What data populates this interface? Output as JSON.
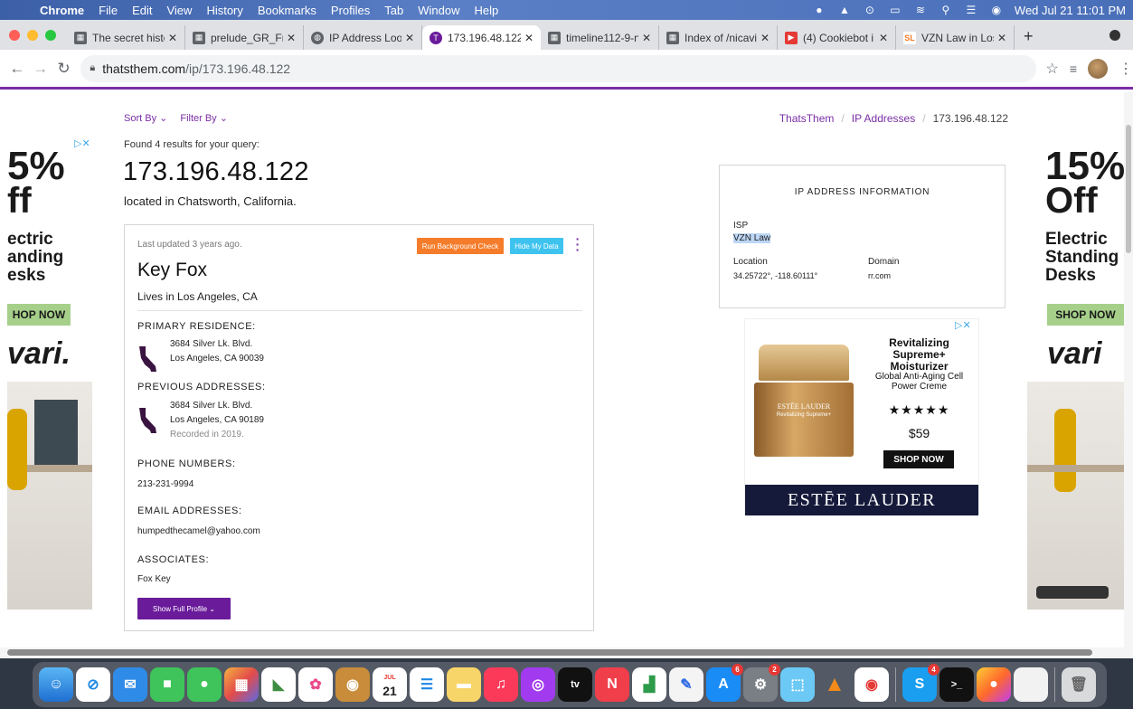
{
  "menubar": {
    "app": "Chrome",
    "items": [
      "File",
      "Edit",
      "View",
      "History",
      "Bookmarks",
      "Profiles",
      "Tab",
      "Window",
      "Help"
    ],
    "clock": "Wed Jul 21  11:01 PM"
  },
  "tabs": [
    {
      "title": "The secret histo",
      "color": "#5f6368",
      "icon": "doc-icon"
    },
    {
      "title": "prelude_GR_Fr",
      "color": "#5f6368",
      "icon": "doc-icon"
    },
    {
      "title": "IP Address Look",
      "color": "#5f6368",
      "icon": "globe-icon"
    },
    {
      "title": "173.196.48.122",
      "color": "#6a1b9a",
      "icon": "thatsthem-icon",
      "active": true
    },
    {
      "title": "timeline112-9-n",
      "color": "#5f6368",
      "icon": "doc-icon"
    },
    {
      "title": "Index of /nicavi",
      "color": "#5f6368",
      "icon": "doc-icon"
    },
    {
      "title": "(4) Cookiebot i",
      "color": "#e53935",
      "icon": "youtube-icon"
    },
    {
      "title": "VZN Law in Los",
      "color": "#f57c2a",
      "icon": "sl-icon"
    }
  ],
  "address": {
    "host": "thatsthem.com",
    "path": "/ip/173.196.48.122"
  },
  "controls": {
    "sort": "Sort By ⌄",
    "filter": "Filter By ⌄"
  },
  "breadcrumb": [
    "ThatsThem",
    "IP Addresses",
    "173.196.48.122"
  ],
  "results": {
    "found": "Found 4 results for your query:",
    "ip": "173.196.48.122",
    "located": "located in Chatsworth, California."
  },
  "person": {
    "updated": "Last updated 3 years ago.",
    "bg_check": "Run Background Check",
    "hide": "Hide My Data",
    "name": "Key Fox",
    "lives": "Lives in Los Angeles, CA",
    "primary_title": "PRIMARY RESIDENCE:",
    "primary_line1": "3684 Silver Lk. Blvd.",
    "primary_line2": "Los Angeles, CA 90039",
    "previous_title": "PREVIOUS ADDRESSES:",
    "previous_line1": "3684 Silver Lk. Blvd.",
    "previous_line2": "Los Angeles, CA 90189",
    "previous_recorded": "Recorded in 2019.",
    "phone_title": "PHONE NUMBERS:",
    "phone": "213-231-9994",
    "email_title": "EMAIL ADDRESSES:",
    "email": "humpedthecamel@yahoo.com",
    "assoc_title": "ASSOCIATES:",
    "associate": "Fox Key",
    "full_profile": "Show Full Profile ⌄"
  },
  "ipinfo": {
    "heading": "IP ADDRESS INFORMATION",
    "isp_label": "ISP",
    "isp": "VZN Law",
    "location_label": "Location",
    "location": "34.25722°, -118.60111°",
    "domain_label": "Domain",
    "domain": "rr.com"
  },
  "ad_left": {
    "pct": "5%",
    "off": "ff",
    "l1": "ectric",
    "l2": "anding",
    "l3": "esks",
    "shop": "HOP NOW",
    "brand": "vari."
  },
  "ad_right": {
    "pct": "15%",
    "off": "Off",
    "l1": "Electric",
    "l2": "Standing",
    "l3": "Desks",
    "shop": "SHOP NOW",
    "brand": "vari"
  },
  "ad_estee": {
    "title": "Revitalizing Supreme+ Moisturizer",
    "sub": "Global Anti-Aging Cell Power Creme",
    "stars": "★★★★★",
    "price": "$59",
    "shop": "SHOP NOW",
    "brand": "ESTĒE LAUDER",
    "jar_brand": "ESTĒE LAUDER",
    "jar_name": "Revitalizing Supreme+"
  },
  "dock_badges": {
    "appstore": "6",
    "sysprefs": "2",
    "skype": "4"
  },
  "calendar": {
    "month": "JUL",
    "day": "21"
  },
  "colors": {
    "accent": "#7a2ea5",
    "orange": "#f57c2a",
    "cyan": "#3ec3ef"
  }
}
